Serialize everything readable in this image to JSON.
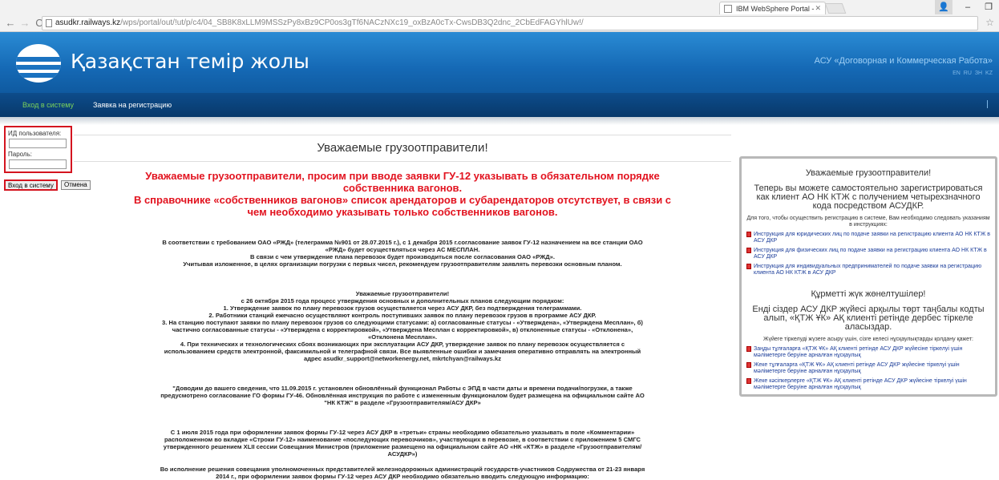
{
  "browser": {
    "tab_title": "IBM WebSphere Portal - ",
    "url_host": "asudkr.railways.kz",
    "url_path": "/wps/portal/out/!ut/p/c4/04_SB8K8xLLM9MSSzPy8xBz9CP0os3gTf6NACzNXc19_oxBzA0cTx-CwsDB3Q2dnc_2CbEdFAGYhlUw!/"
  },
  "header": {
    "site_title": "Қазақстан темір жолы",
    "subtitle": "АСУ «Договорная и Коммерческая Работа»",
    "langs": "EN  RU  ЗН  KZ"
  },
  "nav": {
    "login": "Вход в систему",
    "register": "Заявка на регистрацию"
  },
  "login": {
    "user_label": "ИД пользователя:",
    "password_label": "Пароль:",
    "login_button": "Вход в систему",
    "cancel_button": "Отмена"
  },
  "main": {
    "title": "Уважаемые грузоотправители!",
    "red_lines": [
      "Уважаемые грузоотправители, просим при вводе заявки ГУ-12 указывать в обязательном порядке",
      "собственника вагонов.",
      "В справочнике «собственников вагонов» список арендаторов и субарендаторов отсутствует, в связи с",
      "чем необходимо указывать только собственников вагонов."
    ],
    "para1": [
      "В соответствии с требованием ОАО «РЖД» (телеграмма №901 от 28.07.2015 г.), с 1 декабря 2015 г.согласование заявок ГУ-12 назначением на все станции ОАО",
      "«РЖД» будет осуществляться через АС МЕСПЛАН.",
      "В связи с чем утверждение плана перевозок будет производиться после согласования ОАО «РЖД».",
      "Учитывая изложенное, в целях организации погрузки с первых чисел, рекомендуем грузоотправителям заявлять перевозки основным планом."
    ],
    "para2": [
      "Уважаемые грузоотправители!",
      "с 26 октября 2015 года процесс утверждения основных и дополнительных планов следующим порядком:",
      "1. Утверждение заявок по плану перевозок грузов осуществляется через АСУ ДКР, без подтверждения телеграммами.",
      "2. Работники станций ежечасно осуществляют контроль поступивших заявок по плану перевозок грузов в программе АСУ ДКР.",
      "3. На станцию поступают заявки по плану перевозок грузов со следующими статусами: а) согласованные статусы - «Утверждена», «Утверждена Месплан», б)",
      "частично согласованные статусы - «Утверждена с корректировкой», «Утверждена Месплан с корректировкой», в) отклоненные статусы - «Отклонена»,",
      "«Отклонена Месплан».",
      "4. При технических и технологических сбоях возникающих при эксплуатации АСУ ДКР, утверждение заявок по плану перевозок осуществляется с",
      "использованием средств электронной, факсимильной и телеграфной связи. Все выявленные ошибки и замечания оперативно отправлять на электронный",
      "адрес asudkr_support@networkenergy.net, mkrtchyan@railways.kz"
    ],
    "para3": [
      "\"Доводим до вашего сведения, что 11.09.2015 г. установлен обновлённый функционал Работы с ЭПД в части даты и времени подачи/погрузки, а также",
      "предусмотрено согласование ГО формы ГУ-46. Обновлённая инструкция по работе с измененным функционалом будет размещена на официальном сайте АО",
      "\"НК КТЖ\" в разделе «Грузоотправителям/АСУ ДКР»"
    ],
    "para4": [
      "С 1 июля 2015 года при оформлении заявок формы ГУ-12 через АСУ ДКР в «третьи» страны необходимо обязательно указывать в поле «Комментарии»",
      "расположенном во вкладке «Строки ГУ-12» наименование «последующих перевозчиков», участвующих в перевозке, в соответствии с приложением 5 СМГС",
      "утвержденного решением XLII сессии Совещания Министров (приложение размещено на официальном сайте АО «НК «КТЖ» в разделе «Грузоотправителям/",
      "АСУДКР»)"
    ],
    "para5": [
      "Во исполнение решения совещания уполномоченных представителей железнодорожных администраций государств-участников Содружества от 21-23 января",
      "2014 г., при оформлении заявок формы ГУ-12 через АСУ ДКР необходимо обязательно вводить следующую информацию:"
    ]
  },
  "panel": {
    "title_ru": "Уважаемые грузоотправители!",
    "big_ru": "Теперь вы можете самостоятельно зарегистрироваться как клиент АО НК КТЖ с получением четырехзначного кода посредством АСУДКР.",
    "small_ru": "Для того, чтобы осуществить регистрацию в системе, Вам необходимо следовать указаниям в инструкциях:",
    "links_ru": [
      "Инструкция для юридических лиц по подаче заявки на регистрацию клиента АО НК КТЖ в АСУ ДКР",
      "Инструкция для физических лиц по подаче заявки на регистрацию клиента АО НК КТЖ в АСУ ДКР",
      "Инструкция для индивидуальных предпринимателей по подаче заявки на регистрацию клиента АО НК КТЖ в АСУ ДКР"
    ],
    "title_kz": "Құрметті жүк жөнелтушілер!",
    "big_kz": "Енді сіздер АСУ ДКР жүйесі арқылы төрт таңбалы кодты алып, «ҚТЖ ҰК» АҚ клиенті ретінде дербес тіркеле аласыздар.",
    "small_kz": "Жүйеге тіркелуді жүзеге асыру үшін, сізге келесі нұсқаулықтарды қолдану қажет:",
    "links_kz": [
      "Заңды тұлғаларға «ҚТЖ ҰК» АҚ клиенті ретінде АСУ ДКР жүйесіне тіркелуі үшін мәліметерге беруіне арналған нұсқаулық",
      "Жеке тұлғаларға «ҚТЖ ҰК» АҚ клиенті ретінде АСУ ДКР жүйесіне тіркелуі үшін мәліметерге беруіне арналған нұсқаулық",
      "Жеке кәсіпкерлерге «ҚТЖ ҰК» АҚ клиенті ретінде АСУ ДКР жүйесіне тіркелуі үшін мәліметерге беруіне арналған нұсқаулық"
    ]
  }
}
